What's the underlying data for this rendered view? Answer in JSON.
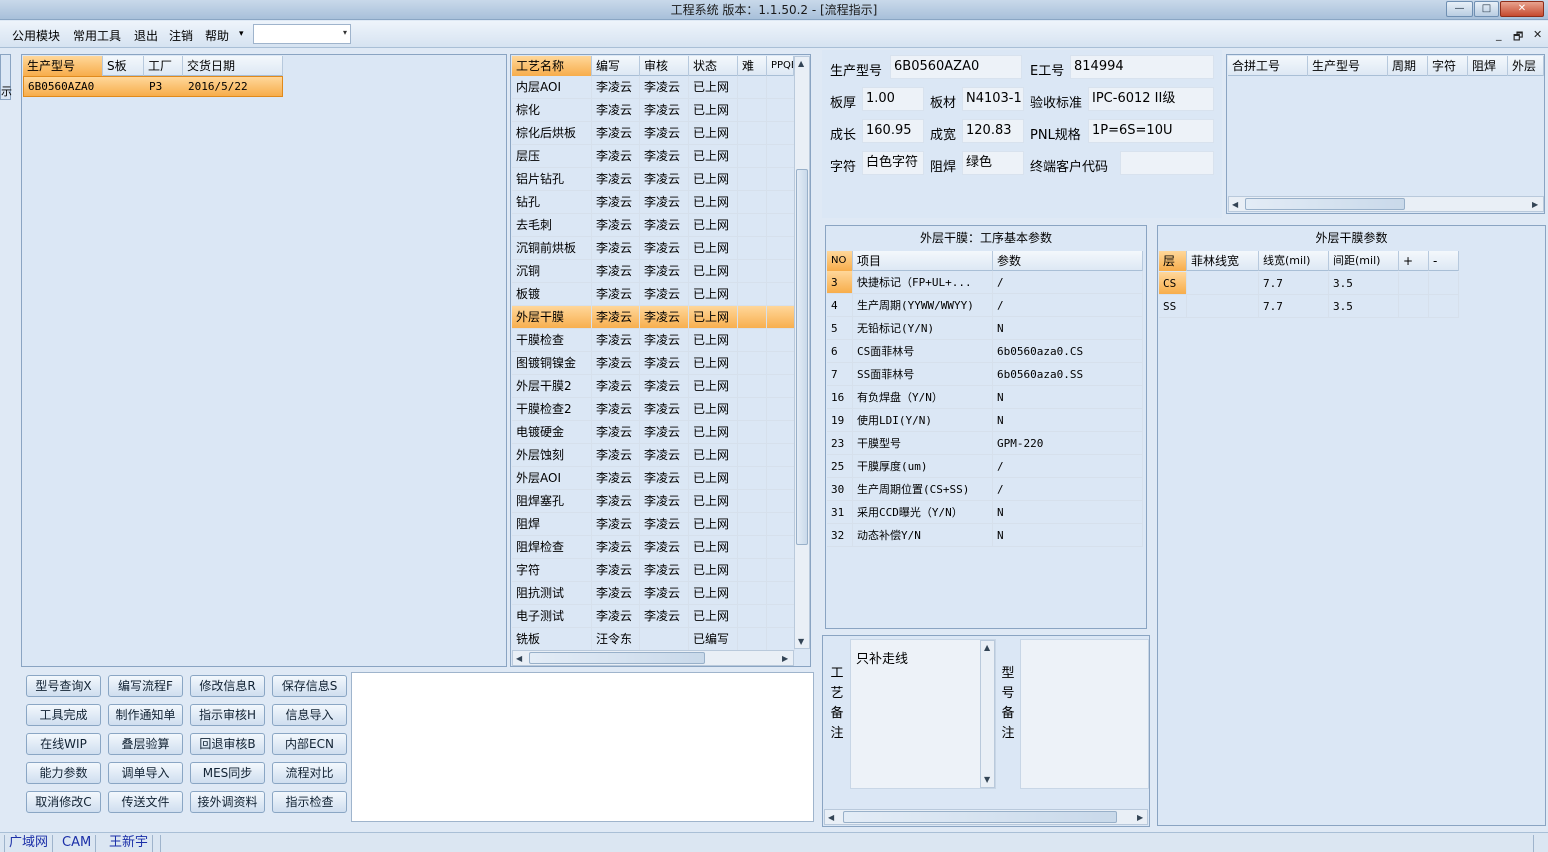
{
  "window": {
    "title": "工程系统    版本：1.1.50.2 - [流程指示]",
    "minimize": "—",
    "maximize": "□",
    "close": "✕"
  },
  "menu": {
    "items": [
      "公用模块",
      "常用工具",
      "退出",
      "注销",
      "帮助"
    ],
    "combo_value": "",
    "combo_arrow": "▾",
    "help_arrow": "▾",
    "mdi_buttons": [
      "_",
      "🗗",
      "✕"
    ]
  },
  "left_edge": {
    "label": "示"
  },
  "order_grid": {
    "headers": [
      "生产型号",
      "S板",
      "工厂",
      "交货日期"
    ],
    "rows": [
      [
        "6B0560AZA0",
        "",
        "P3",
        "2016/5/22"
      ]
    ]
  },
  "process_grid": {
    "headers": [
      "工艺名称",
      "编写",
      "审核",
      "状态",
      "难",
      "PPQE"
    ],
    "selected_index": 10,
    "rows": [
      [
        "内层AOI",
        "李凌云",
        "李凌云",
        "已上网"
      ],
      [
        "棕化",
        "李凌云",
        "李凌云",
        "已上网"
      ],
      [
        "棕化后烘板",
        "李凌云",
        "李凌云",
        "已上网"
      ],
      [
        "层压",
        "李凌云",
        "李凌云",
        "已上网"
      ],
      [
        "铝片钻孔",
        "李凌云",
        "李凌云",
        "已上网"
      ],
      [
        "钻孔",
        "李凌云",
        "李凌云",
        "已上网"
      ],
      [
        "去毛刺",
        "李凌云",
        "李凌云",
        "已上网"
      ],
      [
        "沉铜前烘板",
        "李凌云",
        "李凌云",
        "已上网"
      ],
      [
        "沉铜",
        "李凌云",
        "李凌云",
        "已上网"
      ],
      [
        "板镀",
        "李凌云",
        "李凌云",
        "已上网"
      ],
      [
        "外层干膜",
        "李凌云",
        "李凌云",
        "已上网"
      ],
      [
        "干膜检查",
        "李凌云",
        "李凌云",
        "已上网"
      ],
      [
        "图镀铜镍金",
        "李凌云",
        "李凌云",
        "已上网"
      ],
      [
        "外层干膜2",
        "李凌云",
        "李凌云",
        "已上网"
      ],
      [
        "干膜检查2",
        "李凌云",
        "李凌云",
        "已上网"
      ],
      [
        "电镀硬金",
        "李凌云",
        "李凌云",
        "已上网"
      ],
      [
        "外层蚀刻",
        "李凌云",
        "李凌云",
        "已上网"
      ],
      [
        "外层AOI",
        "李凌云",
        "李凌云",
        "已上网"
      ],
      [
        "阻焊塞孔",
        "李凌云",
        "李凌云",
        "已上网"
      ],
      [
        "阻焊",
        "李凌云",
        "李凌云",
        "已上网"
      ],
      [
        "阻焊检查",
        "李凌云",
        "李凌云",
        "已上网"
      ],
      [
        "字符",
        "李凌云",
        "李凌云",
        "已上网"
      ],
      [
        "阻抗测试",
        "李凌云",
        "李凌云",
        "已上网"
      ],
      [
        "电子测试",
        "李凌云",
        "李凌云",
        "已上网"
      ],
      [
        "铣板",
        "汪令东",
        "",
        "已编写"
      ]
    ]
  },
  "buttons": [
    [
      "型号查询X",
      "编写流程F",
      "修改信息R",
      "保存信息S"
    ],
    [
      "工具完成",
      "制作通知单",
      "指示审核H",
      "信息导入"
    ],
    [
      "在线WIP",
      "叠层验算",
      "回退审核B",
      "内部ECN"
    ],
    [
      "能力参数",
      "调单导入",
      "MES同步",
      "流程对比"
    ],
    [
      "取消修改C",
      "传送文件",
      "接外调资料",
      "指示检查"
    ]
  ],
  "info": {
    "model_label": "生产型号",
    "model": "6B0560AZA0",
    "eno_label": "E工号",
    "eno": "814994",
    "thickness_label": "板厚",
    "thickness": "1.00",
    "material_label": "板材",
    "material": "N4103-1",
    "standard_label": "验收标准",
    "standard": "IPC-6012 II级",
    "length_label": "成长",
    "length": "160.95",
    "width_label": "成宽",
    "width": "120.83",
    "pnl_label": "PNL规格",
    "pnl": "1P=6S=10U",
    "char_label": "字符",
    "char": "白色字符",
    "mask_label": "阻焊",
    "mask": "绿色",
    "customer_label": "终端客户代码",
    "customer": ""
  },
  "merge_grid": {
    "headers": [
      "合拼工号",
      "生产型号",
      "周期",
      "字符",
      "阻焊",
      "外层"
    ]
  },
  "params_panel": {
    "title": "外层干膜：工序基本参数",
    "headers": [
      "NO",
      "项目",
      "参数"
    ],
    "rows": [
      [
        "3",
        "快捷标记（FP+UL+...",
        "/"
      ],
      [
        "4",
        "生产周期(YYWW/WWYY)",
        "/"
      ],
      [
        "5",
        "无铅标记(Y/N)",
        "N"
      ],
      [
        "6",
        "CS面菲林号",
        "6b0560aza0.CS"
      ],
      [
        "7",
        "SS面菲林号",
        "6b0560aza0.SS"
      ],
      [
        "16",
        "有负焊盘（Y/N）",
        "N"
      ],
      [
        "19",
        "使用LDI(Y/N)",
        "N"
      ],
      [
        "23",
        "干膜型号",
        "GPM-220"
      ],
      [
        "25",
        "干膜厚度(um)",
        "/"
      ],
      [
        "30",
        "生产周期位置(CS+SS)",
        "/"
      ],
      [
        "31",
        "采用CCD曝光（Y/N）",
        "N"
      ],
      [
        "32",
        "动态补偿Y/N",
        "N"
      ]
    ]
  },
  "film_panel": {
    "title": "外层干膜参数",
    "headers": [
      "层",
      "菲林线宽",
      "线宽(mil)",
      "间距(mil)",
      "+",
      "-"
    ],
    "rows": [
      [
        "CS",
        "",
        "7.7",
        "3.5",
        "",
        ""
      ],
      [
        "SS",
        "",
        "7.7",
        "3.5",
        "",
        ""
      ]
    ]
  },
  "remarks": {
    "process_label": "工艺备注",
    "process_text": "只补走线",
    "model_label": "型号备注",
    "model_text": ""
  },
  "status": {
    "items": [
      "广域网",
      "CAM",
      "王新宇"
    ]
  },
  "colors": {
    "accent_selected": "#f7ad4b",
    "panel_bg": "#dbe7f5",
    "link_blue": "#1b2fa8"
  }
}
